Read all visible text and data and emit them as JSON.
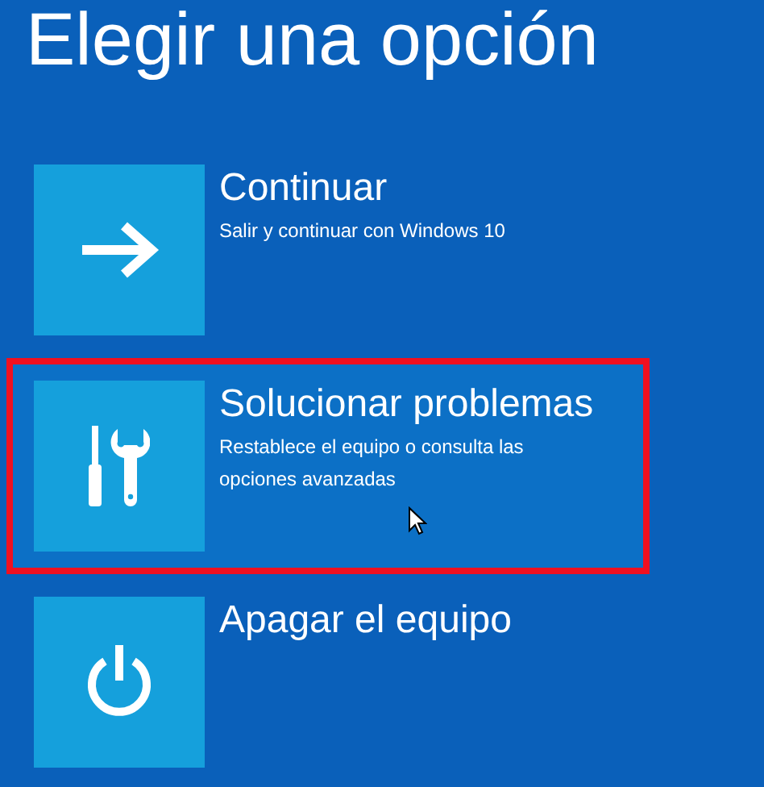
{
  "title": "Elegir una opción",
  "options": [
    {
      "kind": "arrow",
      "label": "Continuar",
      "description": "Salir y continuar con Windows 10",
      "selected": false
    },
    {
      "kind": "tools",
      "label": "Solucionar problemas",
      "description": "Restablece el equipo o consulta las opciones avanzadas",
      "selected": true
    },
    {
      "kind": "power",
      "label": "Apagar el equipo",
      "selected": false
    }
  ]
}
